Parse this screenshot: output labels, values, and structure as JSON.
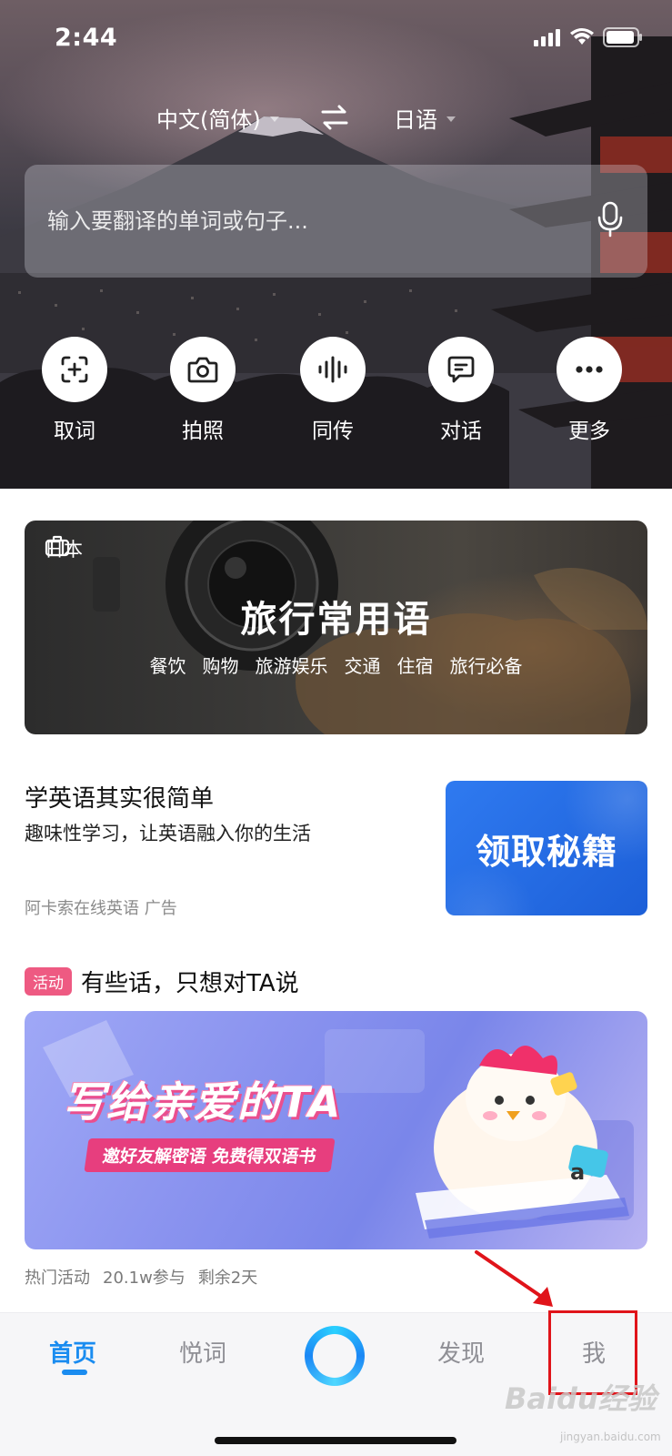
{
  "status_bar": {
    "time": "2:44"
  },
  "languages": {
    "source": "中文(简体)",
    "target": "日语"
  },
  "search": {
    "placeholder": "输入要翻译的单词或句子..."
  },
  "tools": [
    {
      "label": "取词",
      "icon": "scan-word-icon"
    },
    {
      "label": "拍照",
      "icon": "camera-icon"
    },
    {
      "label": "同传",
      "icon": "voice-wave-icon"
    },
    {
      "label": "对话",
      "icon": "chat-bubble-icon"
    },
    {
      "label": "更多",
      "icon": "more-dots-icon"
    }
  ],
  "travel_card": {
    "region": "日本",
    "title": "旅行常用语",
    "tags": [
      "餐饮",
      "购物",
      "旅游娱乐",
      "交通",
      "住宿",
      "旅行必备"
    ]
  },
  "ad": {
    "title": "学英语其实很简单",
    "subtitle": "趣味性学习，让英语融入你的生活",
    "source": "阿卡索在线英语 广告",
    "banner_text": "领取秘籍"
  },
  "activity": {
    "badge": "活动",
    "title": "有些话，只想对TA说",
    "banner_headline": "写给亲爱的TA",
    "banner_ribbon": "邀好友解密语 免费得双语书",
    "meta": {
      "category": "热门活动",
      "participants": "20.1w参与",
      "remaining": "剩余2天"
    }
  },
  "tabbar": {
    "home": "首页",
    "words": "悦词",
    "discover": "发现",
    "me": "我",
    "active": "home"
  },
  "watermark": {
    "brand": "Baidu经验",
    "url": "jingyan.baidu.com"
  },
  "colors": {
    "accent": "#1a8cf0",
    "badge": "#ee5a82",
    "ad_blue": "#2f7af0",
    "annotation_red": "#e0141a"
  }
}
